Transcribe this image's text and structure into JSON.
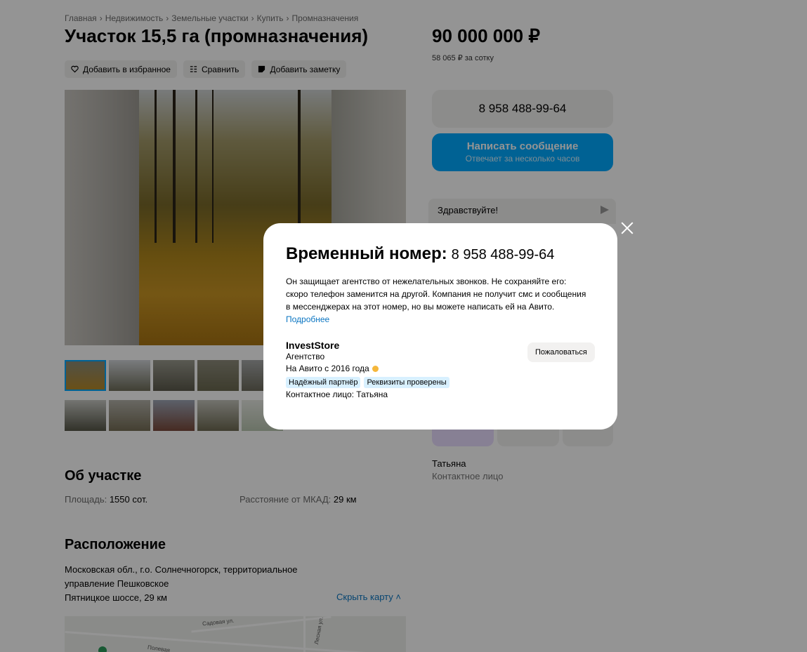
{
  "breadcrumbs": [
    "Главная",
    "Недвижимость",
    "Земельные участки",
    "Купить",
    "Промназначения"
  ],
  "breadcrumb_separator": "›",
  "listing": {
    "title": "Участок 15,5 га (промназначения)",
    "actions": {
      "favorite": "Добавить в избранное",
      "compare": "Сравнить",
      "note": "Добавить заметку"
    }
  },
  "price": {
    "value": "90 000 000 ₽",
    "per_unit": "58 065 ₽ за сотку"
  },
  "contact_buttons": {
    "phone": "8 958 488-99-64",
    "message_label": "Написать сообщение",
    "message_subtitle": "Отвечает за несколько часов"
  },
  "chat": {
    "placeholder": "Здравствуйте!"
  },
  "about": {
    "heading": "Об участке",
    "area_label": "Площадь:",
    "area_value": "1550 сот.",
    "distance_label": "Расстояние от МКАД:",
    "distance_value": "29 км"
  },
  "location": {
    "heading": "Расположение",
    "address_line1": "Московская обл., г.о. Солнечногорск, территориальное",
    "address_line2": "управление Пешковское",
    "address_line3": "Пятницкое шоссе, 29 км",
    "toggle_map": "Скрыть карту ˄",
    "map_labels": [
      "Полевая",
      "Лесная ул.",
      "Садовая ул."
    ]
  },
  "seller_card": {
    "contact_name": "Татьяна",
    "contact_role": "Контактное лицо"
  },
  "modal": {
    "title": "Временный номер:",
    "number": "8 958 488-99-64",
    "description": "Он защищает агентство от нежелательных звонков. Не сохраняйте его: скоро телефон заменится на другой. Компания не получит смс и сообщения в мессенджерах на этот номер, но вы можете написать ей на Авито.",
    "more_link": "Подробнее",
    "seller_name": "InvestStore",
    "seller_type": "Агентство",
    "since": "На Авито с 2016 года",
    "badges": [
      "Надёжный партнёр",
      "Реквизиты проверены"
    ],
    "contact_person": "Контактное лицо: Татьяна",
    "complain_button": "Пожаловаться"
  },
  "colors": {
    "accent_blue": "#00aaff",
    "link_blue": "#0a75c2",
    "overlay": "rgba(0,0,0,0.42)",
    "badge_bg": "#d8f0ff"
  },
  "icons": [
    "heart-icon",
    "compare-icon",
    "note-icon",
    "send-icon",
    "close-icon",
    "medal-icon"
  ]
}
